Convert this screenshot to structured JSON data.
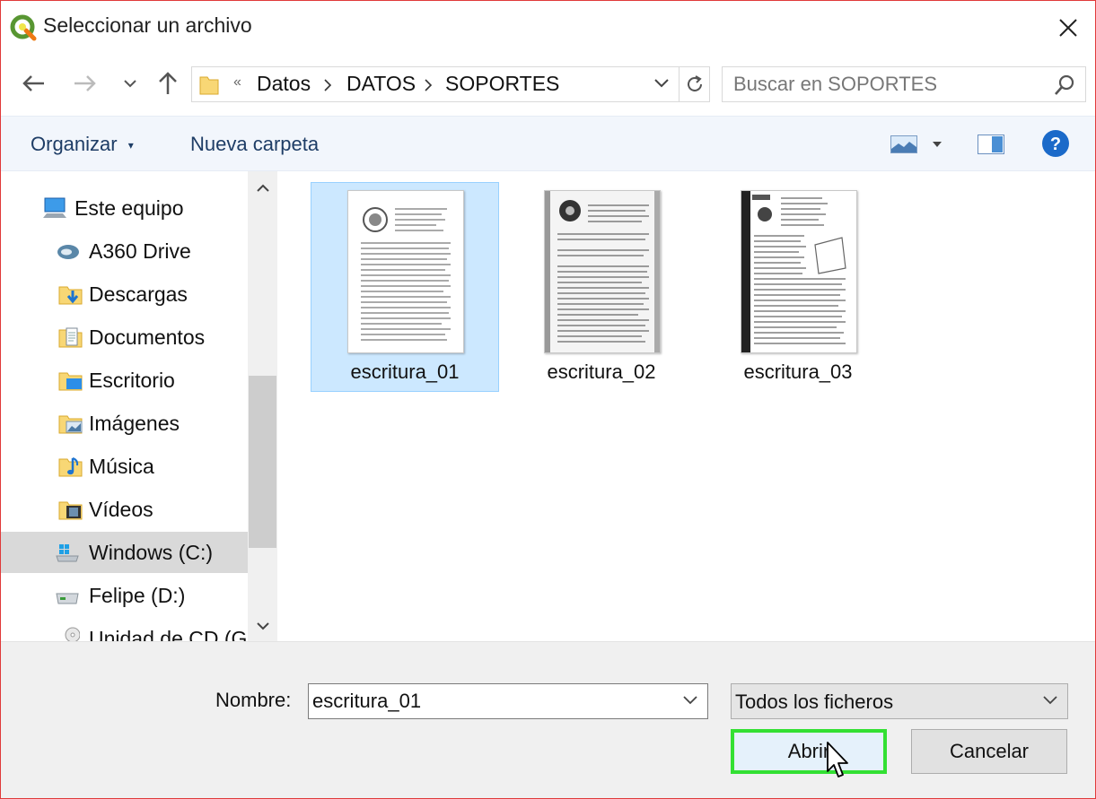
{
  "window": {
    "title": "Seleccionar un archivo",
    "accent_color": "#e03a3a"
  },
  "nav": {
    "breadcrumb_overflow": "«",
    "breadcrumbs": [
      "Datos",
      "DATOS",
      "SOPORTES"
    ],
    "search_placeholder": "Buscar en SOPORTES"
  },
  "toolbar": {
    "organize_label": "Organizar",
    "new_folder_label": "Nueva carpeta"
  },
  "sidebar": {
    "items": [
      {
        "label": "Este equipo",
        "icon": "computer-icon"
      },
      {
        "label": "A360 Drive",
        "icon": "cloud-drive-icon"
      },
      {
        "label": "Descargas",
        "icon": "downloads-folder-icon"
      },
      {
        "label": "Documentos",
        "icon": "documents-folder-icon"
      },
      {
        "label": "Escritorio",
        "icon": "desktop-folder-icon"
      },
      {
        "label": "Imágenes",
        "icon": "pictures-folder-icon"
      },
      {
        "label": "Música",
        "icon": "music-folder-icon"
      },
      {
        "label": "Vídeos",
        "icon": "videos-folder-icon"
      },
      {
        "label": "Windows (C:)",
        "icon": "windows-drive-icon",
        "selected": true
      },
      {
        "label": "Felipe (D:)",
        "icon": "drive-icon"
      },
      {
        "label": "Unidad de CD (G",
        "icon": "cd-drive-icon"
      }
    ]
  },
  "files": [
    {
      "name": "escritura_01",
      "selected": true
    },
    {
      "name": "escritura_02",
      "selected": false
    },
    {
      "name": "escritura_03",
      "selected": false
    }
  ],
  "footer": {
    "name_label": "Nombre:",
    "filename_value": "escritura_01",
    "file_type": "Todos los ficheros",
    "open_label": "Abrir",
    "cancel_label": "Cancelar",
    "highlight_color": "#33e033"
  }
}
